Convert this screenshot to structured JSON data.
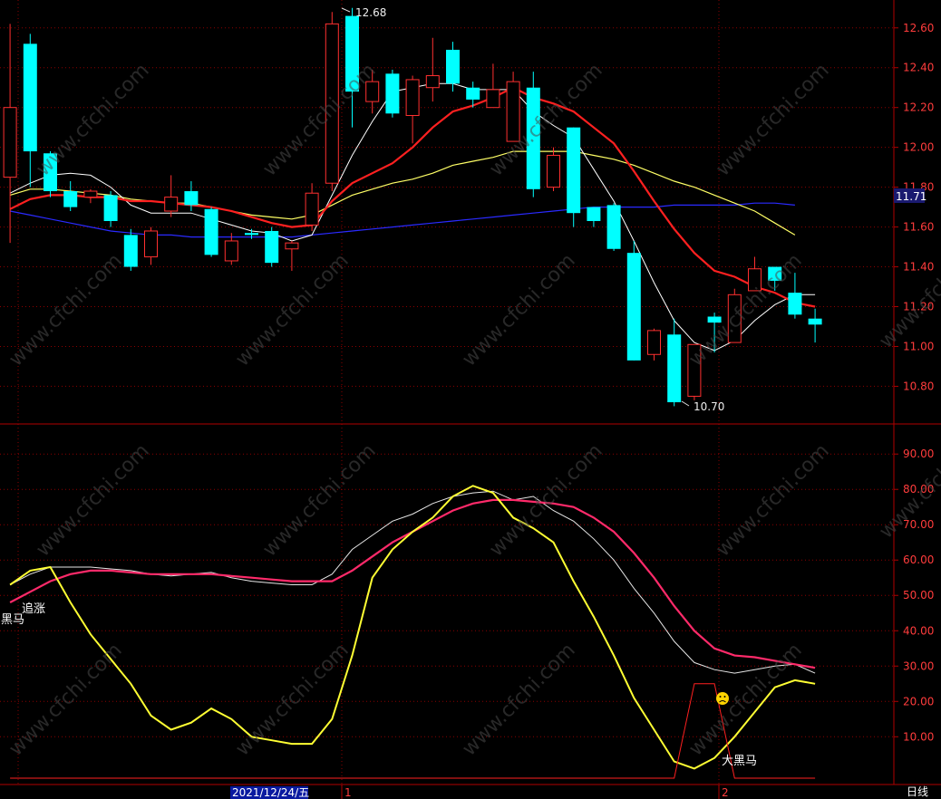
{
  "watermark": "www.cfchi.com",
  "colors": {
    "bg": "#000000",
    "grid": "#8b0000",
    "axis": "#b00000",
    "up": "#ff3030",
    "down": "#00ffff",
    "ma_white": "#ffffff",
    "ma_red": "#ff2020",
    "ma_yellow": "#ffff66",
    "ma_blue": "#2a2aff",
    "osc_yellow": "#ffff33",
    "osc_pink": "#ff2a6a",
    "osc_white": "#e6e6e6",
    "signal_red": "#ff2020",
    "tick_text": "#ff3c3c"
  },
  "price_panel": {
    "yticks": [
      "12.60",
      "12.40",
      "12.20",
      "12.00",
      "11.80",
      "11.60",
      "11.40",
      "11.20",
      "11.00",
      "10.80"
    ],
    "current_price": "11.71",
    "max_label": "12.68",
    "min_label": "10.70"
  },
  "osc_panel": {
    "yticks": [
      "90.00",
      "80.00",
      "70.00",
      "60.00",
      "50.00",
      "40.00",
      "30.00",
      "20.00",
      "10.00"
    ],
    "labels": {
      "zhuizhang": "追涨",
      "heima": "黑马",
      "daheima": "大黑马"
    }
  },
  "x_axis": {
    "date_label": "2021/12/24/五",
    "month_1": "1",
    "month_2": "2",
    "period": "日线"
  },
  "chart_data": {
    "type": "candlestick",
    "price_ylim": [
      10.62,
      12.74
    ],
    "candles": [
      [
        11.85,
        12.2,
        12.62,
        11.52
      ],
      [
        12.52,
        11.98,
        12.57,
        11.8
      ],
      [
        11.97,
        11.78,
        11.98,
        11.75
      ],
      [
        11.78,
        11.7,
        11.83,
        11.68
      ],
      [
        11.75,
        11.78,
        11.79,
        11.72
      ],
      [
        11.76,
        11.63,
        11.78,
        11.6
      ],
      [
        11.56,
        11.4,
        11.59,
        11.38
      ],
      [
        11.45,
        11.58,
        11.6,
        11.41
      ],
      [
        11.68,
        11.75,
        11.86,
        11.65
      ],
      [
        11.78,
        11.71,
        11.83,
        11.68
      ],
      [
        11.69,
        11.46,
        11.7,
        11.45
      ],
      [
        11.43,
        11.53,
        11.57,
        11.41
      ],
      [
        11.57,
        11.56,
        11.59,
        11.54
      ],
      [
        11.58,
        11.42,
        11.6,
        11.4
      ],
      [
        11.49,
        11.52,
        11.53,
        11.38
      ],
      [
        11.61,
        11.77,
        11.82,
        11.58
      ],
      [
        11.82,
        12.62,
        12.68,
        11.78
      ],
      [
        12.66,
        12.28,
        12.7,
        12.1
      ],
      [
        12.23,
        12.33,
        12.39,
        12.17
      ],
      [
        12.37,
        12.17,
        12.39,
        12.15
      ],
      [
        12.16,
        12.34,
        12.36,
        12.02
      ],
      [
        12.3,
        12.36,
        12.55,
        12.23
      ],
      [
        12.49,
        12.32,
        12.53,
        12.28
      ],
      [
        12.3,
        12.24,
        12.33,
        12.2
      ],
      [
        12.2,
        12.29,
        12.42,
        12.21
      ],
      [
        12.03,
        12.33,
        12.38,
        12.12
      ],
      [
        12.3,
        11.79,
        12.38,
        11.75
      ],
      [
        11.8,
        11.96,
        12.0,
        11.78
      ],
      [
        12.1,
        11.67,
        12.1,
        11.6
      ],
      [
        11.7,
        11.63,
        11.7,
        11.6
      ],
      [
        11.71,
        11.49,
        11.72,
        11.48
      ],
      [
        11.47,
        10.93,
        11.53,
        10.93
      ],
      [
        10.96,
        11.08,
        11.09,
        10.93
      ],
      [
        11.06,
        10.72,
        11.14,
        10.7
      ],
      [
        10.75,
        11.01,
        11.01,
        10.73
      ],
      [
        11.15,
        11.12,
        11.17,
        10.97
      ],
      [
        11.02,
        11.26,
        11.29,
        11.02
      ],
      [
        11.28,
        11.39,
        11.45,
        11.28
      ],
      [
        11.4,
        11.33,
        11.4,
        11.28
      ],
      [
        11.27,
        11.16,
        11.37,
        11.14
      ],
      [
        11.14,
        11.11,
        11.19,
        11.02
      ]
    ],
    "ma_white": [
      11.77,
      11.82,
      11.86,
      11.87,
      11.86,
      11.8,
      11.71,
      11.67,
      11.67,
      11.67,
      11.64,
      11.61,
      11.58,
      11.57,
      11.53,
      11.56,
      11.76,
      11.96,
      12.13,
      12.28,
      12.3,
      12.32,
      12.32,
      12.29,
      12.29,
      12.29,
      12.18,
      12.11,
      12.05,
      11.89,
      11.73,
      11.53,
      11.32,
      11.13,
      11.02,
      10.98,
      11.03,
      11.13,
      11.21,
      11.26,
      11.26
    ],
    "ma_red": [
      11.69,
      11.74,
      11.76,
      11.76,
      11.75,
      11.75,
      11.73,
      11.73,
      11.72,
      11.71,
      11.7,
      11.68,
      11.65,
      11.62,
      11.6,
      11.61,
      11.73,
      11.82,
      11.87,
      11.92,
      12.0,
      12.1,
      12.18,
      12.21,
      12.25,
      12.3,
      12.25,
      12.22,
      12.18,
      12.1,
      12.02,
      11.88,
      11.73,
      11.59,
      11.47,
      11.38,
      11.35,
      11.3,
      11.27,
      11.22,
      11.2
    ],
    "ma_yellow": [
      11.76,
      11.79,
      11.79,
      11.78,
      11.77,
      11.76,
      11.74,
      11.73,
      11.72,
      11.72,
      11.7,
      11.68,
      11.66,
      11.65,
      11.64,
      11.66,
      11.71,
      11.76,
      11.79,
      11.82,
      11.84,
      11.87,
      11.91,
      11.93,
      11.95,
      11.98,
      11.98,
      11.98,
      11.98,
      11.96,
      11.94,
      11.91,
      11.87,
      11.83,
      11.8,
      11.76,
      11.72,
      11.68,
      11.62,
      11.56
    ],
    "ma_blue": [
      11.68,
      11.66,
      11.64,
      11.62,
      11.6,
      11.58,
      11.57,
      11.56,
      11.56,
      11.55,
      11.55,
      11.55,
      11.55,
      11.55,
      11.55,
      11.56,
      11.57,
      11.58,
      11.59,
      11.6,
      11.61,
      11.62,
      11.63,
      11.64,
      11.65,
      11.66,
      11.67,
      11.68,
      11.69,
      11.7,
      11.7,
      11.7,
      11.7,
      11.71,
      11.71,
      11.71,
      11.71,
      11.72,
      11.72,
      11.71
    ],
    "osc_ylim": [
      -3,
      98
    ],
    "osc_yellow": [
      53,
      57,
      58,
      48,
      39,
      32,
      25,
      16,
      12,
      14,
      18,
      15,
      10,
      9,
      8,
      8,
      15,
      33,
      55,
      63,
      68,
      72,
      78,
      81,
      79,
      72,
      69,
      65,
      54,
      44,
      33,
      21,
      12,
      3,
      1,
      4,
      10,
      17,
      24,
      26,
      25
    ],
    "osc_pink": [
      48,
      51,
      54,
      56,
      57,
      57,
      56.5,
      56,
      56,
      56,
      56,
      55.5,
      55,
      54.5,
      54,
      54,
      54,
      57,
      61,
      65,
      68,
      71,
      74,
      76,
      77,
      77,
      76.5,
      76,
      75,
      72,
      68,
      62,
      55,
      47,
      40,
      35,
      33,
      32.5,
      31.5,
      30.5,
      29.5
    ],
    "osc_white": [
      53,
      56,
      58,
      58,
      58,
      57.5,
      57,
      56,
      55.5,
      56,
      56.5,
      55,
      54,
      53.5,
      53,
      53,
      56,
      63,
      67,
      71,
      73,
      76,
      78,
      79,
      79.5,
      77,
      78,
      74,
      71,
      66,
      60,
      52,
      45,
      37,
      31,
      29,
      28,
      29,
      30,
      30.5,
      28
    ],
    "signal": [
      0,
      0,
      0,
      0,
      0,
      0,
      0,
      0,
      0,
      0,
      0,
      0,
      0,
      0,
      0,
      0,
      0,
      0,
      0,
      0,
      0,
      0,
      0,
      0,
      0,
      0,
      0,
      0,
      0,
      0,
      0,
      0,
      0,
      0,
      25,
      25,
      0,
      0,
      0,
      0,
      0
    ]
  }
}
